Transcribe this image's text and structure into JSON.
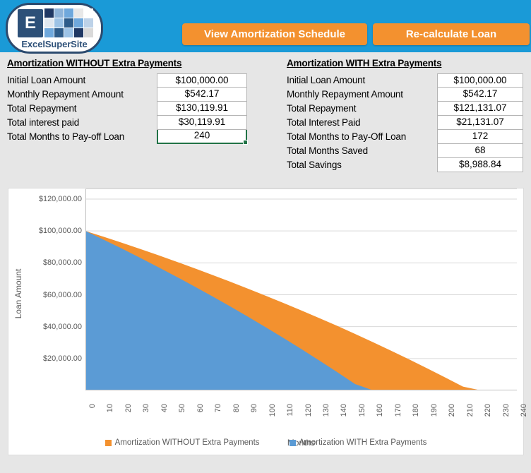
{
  "header": {
    "background_color": "#1a9ad7",
    "logo": {
      "letter": "E",
      "brand": "ExcelSuperSite"
    },
    "buttons": [
      {
        "name": "view-amortization-schedule-button",
        "label": "View Amortization Schedule"
      },
      {
        "name": "re-calculate-loan-button",
        "label": "Re-calculate Loan"
      }
    ],
    "button_color": "#f3912f"
  },
  "panel_without": {
    "title": "Amortization WITHOUT Extra Payments",
    "rows": [
      {
        "label": "Initial Loan Amount",
        "value": "$100,000.00",
        "selected": false
      },
      {
        "label": "Monthly Repayment Amount",
        "value": "$542.17",
        "selected": false
      },
      {
        "label": "Total Repayment",
        "value": "$130,119.91",
        "selected": false
      },
      {
        "label": "Total interest paid",
        "value": "$30,119.91",
        "selected": false
      },
      {
        "label": "Total Months to Pay-off Loan",
        "value": "240",
        "selected": true
      }
    ]
  },
  "panel_with": {
    "title": "Amortization WITH Extra Payments",
    "rows": [
      {
        "label": "Initial Loan Amount",
        "value": "$100,000.00",
        "selected": false
      },
      {
        "label": "Monthly Repayment Amount",
        "value": "$542.17",
        "selected": false
      },
      {
        "label": "Total Repayment",
        "value": "$121,131.07",
        "selected": false
      },
      {
        "label": "Total Interest Paid",
        "value": "$21,131.07",
        "selected": false
      },
      {
        "label": "Total Months to Pay-Off Loan",
        "value": "172",
        "selected": false
      },
      {
        "label": "Total Months Saved",
        "value": "68",
        "selected": false
      },
      {
        "label": "Total Savings",
        "value": "$8,988.84",
        "selected": false
      }
    ]
  },
  "selection_color": "#217346",
  "chart_data": {
    "type": "area",
    "title": "",
    "xlabel": "Months",
    "ylabel": "Loan Amount",
    "xlim": [
      0,
      240
    ],
    "ylim": [
      0,
      120000
    ],
    "grid": true,
    "legend_position": "bottom",
    "xticks": [
      0,
      10,
      20,
      30,
      40,
      50,
      60,
      70,
      80,
      90,
      100,
      110,
      120,
      130,
      140,
      150,
      160,
      170,
      180,
      190,
      200,
      210,
      220,
      230,
      240
    ],
    "yticks": [
      0,
      20000,
      40000,
      60000,
      80000,
      100000,
      120000
    ],
    "ytick_labels": [
      "",
      "$20,000.00",
      "$40,000.00",
      "$60,000.00",
      "$80,000.00",
      "$100,000.00",
      "$120,000.00"
    ],
    "series": [
      {
        "name": "Amortization WITHOUT Extra Payments",
        "color": "#f3912f",
        "x": [
          0,
          10,
          20,
          30,
          40,
          50,
          60,
          70,
          80,
          90,
          100,
          110,
          120,
          130,
          140,
          150,
          160,
          170,
          180,
          190,
          200,
          210,
          220,
          230,
          240
        ],
        "values": [
          100000,
          96400,
          92700,
          88900,
          85000,
          81000,
          76900,
          72700,
          68400,
          64000,
          59500,
          54900,
          50200,
          45400,
          40500,
          35400,
          30200,
          24900,
          19500,
          13900,
          8200,
          2400,
          0,
          0,
          0
        ]
      },
      {
        "name": "Amortization WITH Extra Payments",
        "color": "#5b9bd5",
        "x": [
          0,
          10,
          20,
          30,
          40,
          50,
          60,
          70,
          80,
          90,
          100,
          110,
          120,
          130,
          140,
          150,
          160,
          170,
          172,
          180,
          190,
          200,
          210,
          220,
          230,
          240
        ],
        "values": [
          100000,
          94600,
          89100,
          83400,
          77600,
          71700,
          65600,
          59400,
          53000,
          46500,
          39800,
          33000,
          26000,
          18800,
          11500,
          4000,
          0,
          0,
          0,
          0,
          0,
          0,
          0,
          0,
          0,
          0
        ]
      }
    ]
  }
}
